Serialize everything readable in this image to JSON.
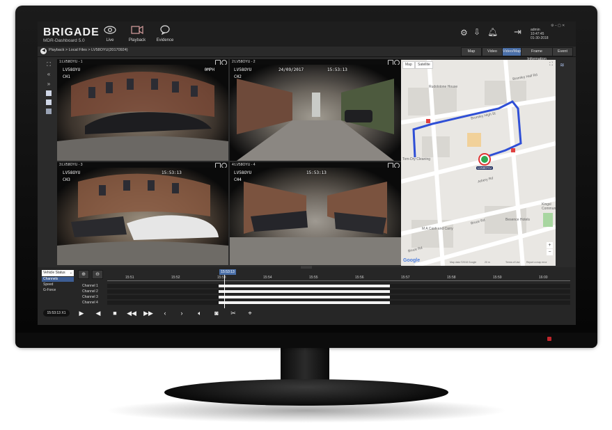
{
  "app": {
    "brand": "BRIGADE",
    "product": "MDR-Dashboard 5.0",
    "nav": [
      {
        "label": "Live",
        "icon": "eye-icon"
      },
      {
        "label": "Playback",
        "icon": "video-camera-icon"
      },
      {
        "label": "Evidence",
        "icon": "chat-bubble-icon"
      }
    ],
    "user": {
      "name": "admin",
      "time": "10:47:45",
      "date": "01-30-2018"
    }
  },
  "breadcrumb": "Playback > Local Files > LV58OYU(20170924)",
  "view_tabs": [
    "Map",
    "Video",
    "Video/Map",
    "Frame Information",
    "Event"
  ],
  "active_view_tab": "Video/Map",
  "cameras": [
    {
      "title": "1:LV58OYU - 1",
      "osd_id": "LV58OYU",
      "osd_speed": "0MPH",
      "osd_ch": "CH1"
    },
    {
      "title": "2:LV58OYU - 2",
      "osd_id": "LV58OYU",
      "osd_date": "24/09/2017",
      "osd_time": "15:53:13",
      "osd_ch": "CH2"
    },
    {
      "title": "3:LV58OYU - 3",
      "osd_id": "LV58OYU",
      "osd_time": "15:53:13",
      "osd_ch": "CH3"
    },
    {
      "title": "4:LV58OYU - 4",
      "osd_id": "LV58OYU",
      "osd_time": "15:53:13",
      "osd_ch": "CH4"
    }
  ],
  "map": {
    "tabs": [
      "Map",
      "Satellite"
    ],
    "places": [
      "Rudolstone House",
      "Bromley High St",
      "Bromley Hall Rd",
      "Arbery Rd",
      "M A Cash and Carry",
      "Bruce Rd",
      "Besence Hotels",
      "Kingsl Commun",
      "Tom-Dry Cleaning",
      "Bruce Rd"
    ],
    "vehicle_label": "LV58OYU",
    "footer": [
      "Google",
      "Map data ©2018 Google",
      "20 m",
      "Terms of Use",
      "Report a map error"
    ],
    "route_color": "#2f4fd6"
  },
  "timeline": {
    "selector": "Vehicle Status",
    "status_items": [
      "Channels",
      "Speed",
      "G-Force"
    ],
    "selected_status": "Channels",
    "ticks": [
      "15:51",
      "15:52",
      "15:53",
      "15:54",
      "15:55",
      "15:56",
      "15:57",
      "15:58",
      "15:59",
      "16:00"
    ],
    "cursor_time": "15:53:13",
    "channels": [
      "Channel 1",
      "Channel 2",
      "Channel 3",
      "Channel 4"
    ],
    "playback_time": "15:53:13",
    "playback_speed": "X1",
    "recorded_from": 0.24,
    "recorded_to": 0.61
  }
}
